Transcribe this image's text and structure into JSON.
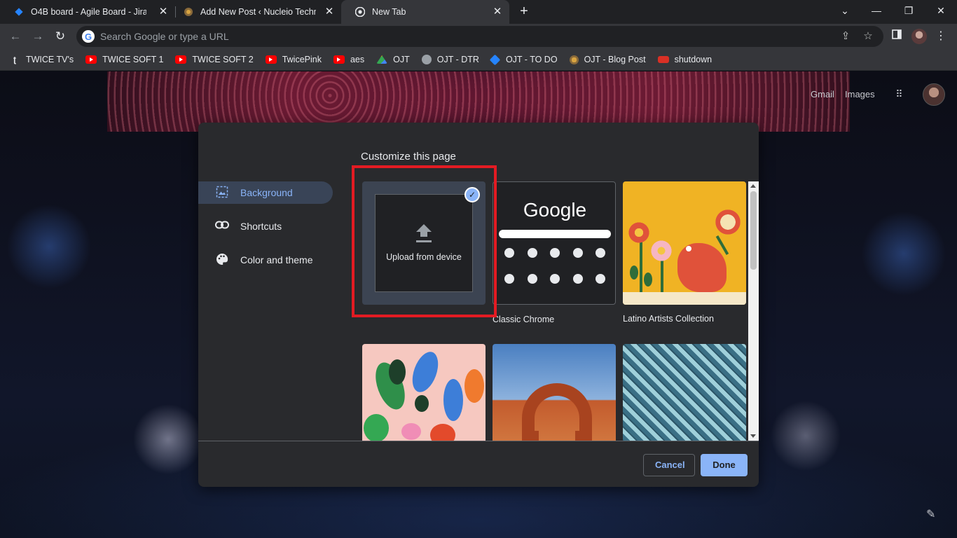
{
  "tabs": [
    {
      "title": "O4B board - Agile Board - Jira",
      "icon": "jira-icon"
    },
    {
      "title": "Add New Post ‹ Nucleio Technolo",
      "icon": "nucleio-icon"
    },
    {
      "title": "New Tab",
      "icon": "chrome-icon"
    }
  ],
  "toolbar": {
    "omnibox_placeholder": "Search Google or type a URL"
  },
  "bookmarks": [
    {
      "label": "TWICE TV's",
      "icon": "twice-icon"
    },
    {
      "label": "TWICE SOFT 1",
      "icon": "youtube-icon"
    },
    {
      "label": "TWICE SOFT 2",
      "icon": "youtube-icon"
    },
    {
      "label": "TwicePink",
      "icon": "youtube-icon"
    },
    {
      "label": "aes",
      "icon": "youtube-icon"
    },
    {
      "label": "OJT",
      "icon": "drive-icon"
    },
    {
      "label": "OJT - DTR",
      "icon": "globe-icon"
    },
    {
      "label": "OJT - TO DO",
      "icon": "jira-icon"
    },
    {
      "label": "OJT - Blog Post",
      "icon": "nucleio-icon"
    },
    {
      "label": "shutdown",
      "icon": "shutdown-icon"
    }
  ],
  "ntp": {
    "gmail": "Gmail",
    "images": "Images"
  },
  "dialog": {
    "title": "Customize this page",
    "sidebar": [
      {
        "label": "Background",
        "icon": "image-icon",
        "selected": true
      },
      {
        "label": "Shortcuts",
        "icon": "link-icon",
        "selected": false
      },
      {
        "label": "Color and theme",
        "icon": "palette-icon",
        "selected": false
      }
    ],
    "tiles": {
      "upload": "Upload from device",
      "classic": "Classic Chrome",
      "classic_logo": "Google",
      "latino": "Latino Artists Collection"
    },
    "cancel": "Cancel",
    "done": "Done"
  },
  "colors": {
    "accent": "#8ab4f8",
    "highlight": "#e31b23",
    "dialog_bg": "#292a2d"
  }
}
